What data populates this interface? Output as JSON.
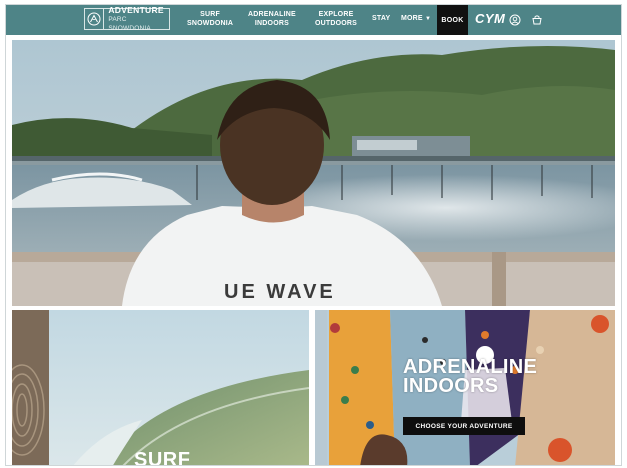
{
  "nav": {
    "logo": {
      "line1": "ADVENTURE",
      "line2": "PARC SNOWDONIA",
      "icon": "mountain-logo-icon"
    },
    "items": [
      {
        "line1": "SURF",
        "line2": "SNOWDONIA"
      },
      {
        "line1": "ADRENALINE",
        "line2": "INDOORS"
      },
      {
        "line1": "EXPLORE",
        "line2": "OUTDOORS"
      }
    ],
    "stay": "STAY",
    "more": "MORE",
    "book": "BOOK",
    "language": "CYM",
    "account_icon": "user-icon",
    "basket_icon": "basket-icon",
    "bar_color": "#4e8487"
  },
  "hero": {
    "shirt_text": "UE WAVE"
  },
  "tiles": {
    "surf": {
      "label": "SURF"
    },
    "adrenaline": {
      "title_line1": "ADRENALINE",
      "title_line2": "INDOORS",
      "cta": "CHOOSE YOUR ADVENTURE"
    }
  }
}
